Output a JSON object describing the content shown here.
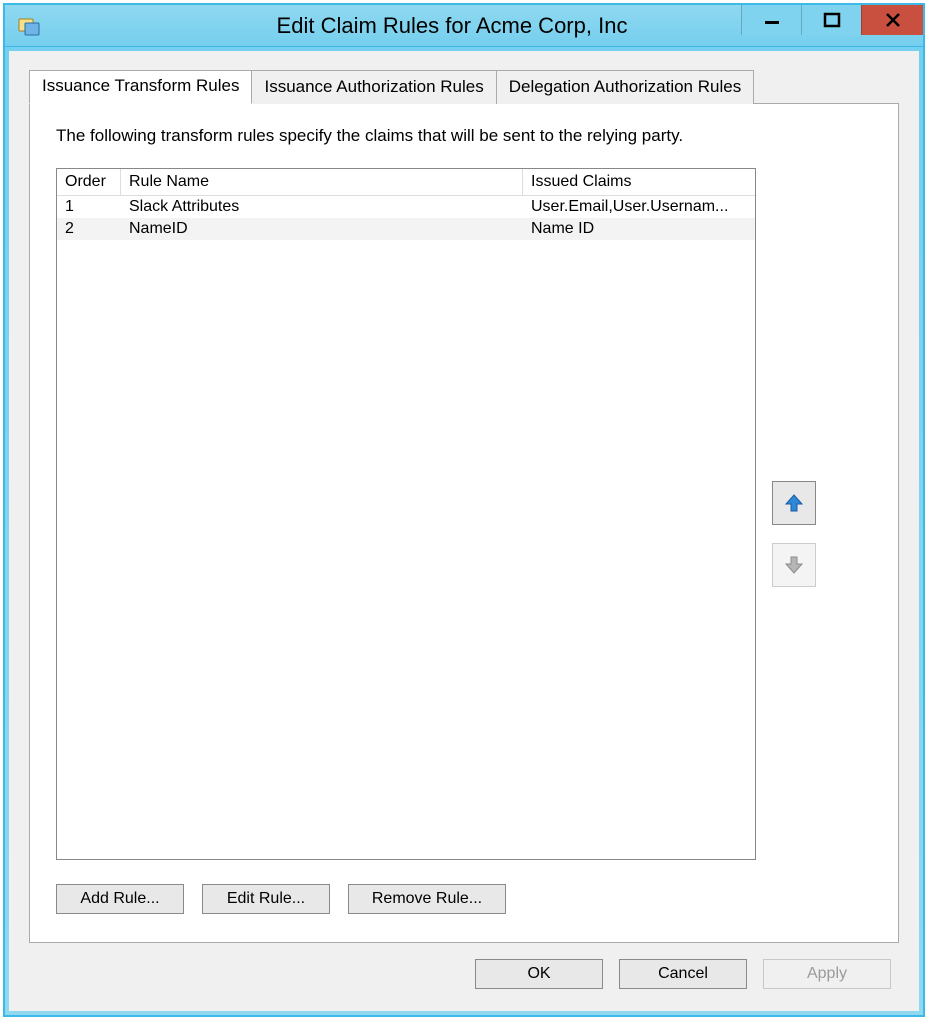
{
  "window": {
    "title": "Edit Claim Rules for Acme Corp, Inc"
  },
  "tabs": [
    {
      "label": "Issuance Transform Rules",
      "active": true
    },
    {
      "label": "Issuance Authorization Rules",
      "active": false
    },
    {
      "label": "Delegation Authorization Rules",
      "active": false
    }
  ],
  "description": "The following transform rules specify the claims that will be sent to the relying party.",
  "columns": {
    "order": "Order",
    "rule_name": "Rule Name",
    "issued_claims": "Issued Claims"
  },
  "rules": [
    {
      "order": "1",
      "name": "Slack Attributes",
      "claims": "User.Email,User.Usernam..."
    },
    {
      "order": "2",
      "name": "NameID",
      "claims": "Name ID"
    }
  ],
  "buttons": {
    "add_rule": "Add Rule...",
    "edit_rule": "Edit Rule...",
    "remove_rule": "Remove Rule...",
    "ok": "OK",
    "cancel": "Cancel",
    "apply": "Apply"
  },
  "move": {
    "up_enabled": true,
    "down_enabled": false
  }
}
